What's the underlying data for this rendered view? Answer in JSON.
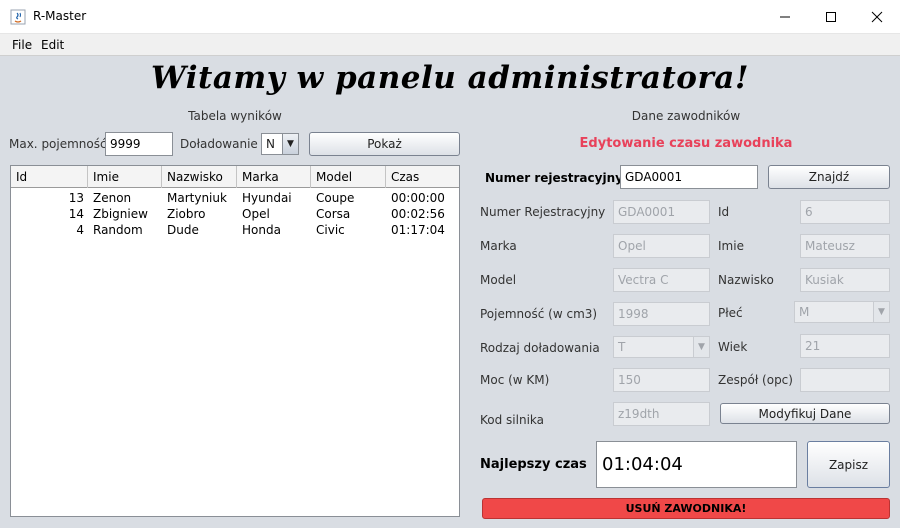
{
  "window": {
    "title": "R-Master"
  },
  "menu": {
    "items": [
      "File",
      "Edit"
    ]
  },
  "heading": "Witamy w panelu administratora!",
  "results": {
    "title": "Tabela wyników",
    "capacity_label": "Max. pojemność",
    "capacity_value": "9999",
    "charging_label": "Doładowanie",
    "charging_value": "N",
    "show_button": "Pokaż",
    "columns": [
      "Id",
      "Imie",
      "Nazwisko",
      "Marka",
      "Model",
      "Czas"
    ],
    "rows": [
      [
        "13",
        "Zenon",
        "Martyniuk",
        "Hyundai",
        "Coupe",
        "00:00:00"
      ],
      [
        "14",
        "Zbigniew",
        "Ziobro",
        "Opel",
        "Corsa",
        "00:02:56"
      ],
      [
        "4",
        "Random",
        "Dude",
        "Honda",
        "Civic",
        "01:17:04"
      ]
    ]
  },
  "driver": {
    "title": "Dane zawodników",
    "subtitle": "Edytowanie czasu zawodnika",
    "reg_label": "Numer rejestracyjny",
    "reg_value": "GDA0001",
    "find_button": "Znajdź",
    "fields": {
      "reg": {
        "label": "Numer Rejestracyjny",
        "value": "GDA0001"
      },
      "id": {
        "label": "Id",
        "value": "6"
      },
      "brand": {
        "label": "Marka",
        "value": "Opel"
      },
      "first_name": {
        "label": "Imie",
        "value": "Mateusz"
      },
      "model": {
        "label": "Model",
        "value": "Vectra C"
      },
      "last_name": {
        "label": "Nazwisko",
        "value": "Kusiak"
      },
      "capacity": {
        "label": "Pojemność (w cm3)",
        "value": "1998"
      },
      "gender": {
        "label": "Płeć",
        "value": "M"
      },
      "charging": {
        "label": "Rodzaj doładowania",
        "value": "T"
      },
      "age": {
        "label": "Wiek",
        "value": "21"
      },
      "power": {
        "label": "Moc (w KM)",
        "value": "150"
      },
      "team": {
        "label": "Zespół (opc)",
        "value": ""
      },
      "engine": {
        "label": "Kod silnika",
        "value": "z19dth"
      }
    },
    "modify_button": "Modyfikuj Dane",
    "best_time_label": "Najlepszy czas",
    "best_time_value": "01:04:04",
    "save_button": "Zapisz",
    "delete_button": "USUŃ ZAWODNIKA!"
  },
  "colors": {
    "subtitle": "#e8415a",
    "delete_button": "#f04848",
    "background": "#d9dde3"
  }
}
